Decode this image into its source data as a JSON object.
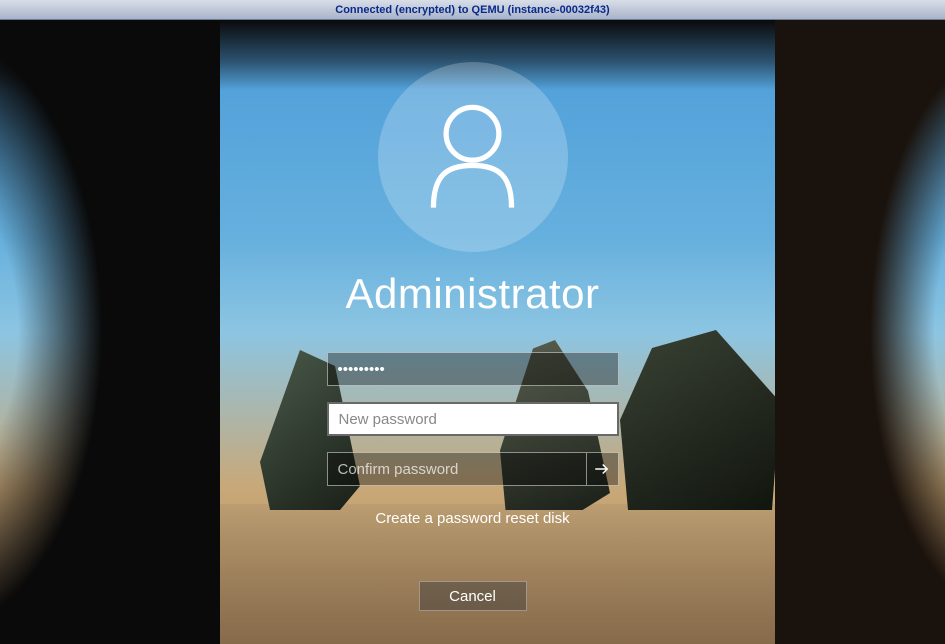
{
  "vnc": {
    "status": "Connected (encrypted) to QEMU (instance-00032f43)"
  },
  "login": {
    "username": "Administrator",
    "current_password_value": "•••••••••",
    "new_password_placeholder": "New password",
    "new_password_value": "",
    "confirm_password_placeholder": "Confirm password",
    "confirm_password_value": "",
    "reset_link_label": "Create a password reset disk",
    "cancel_label": "Cancel"
  }
}
